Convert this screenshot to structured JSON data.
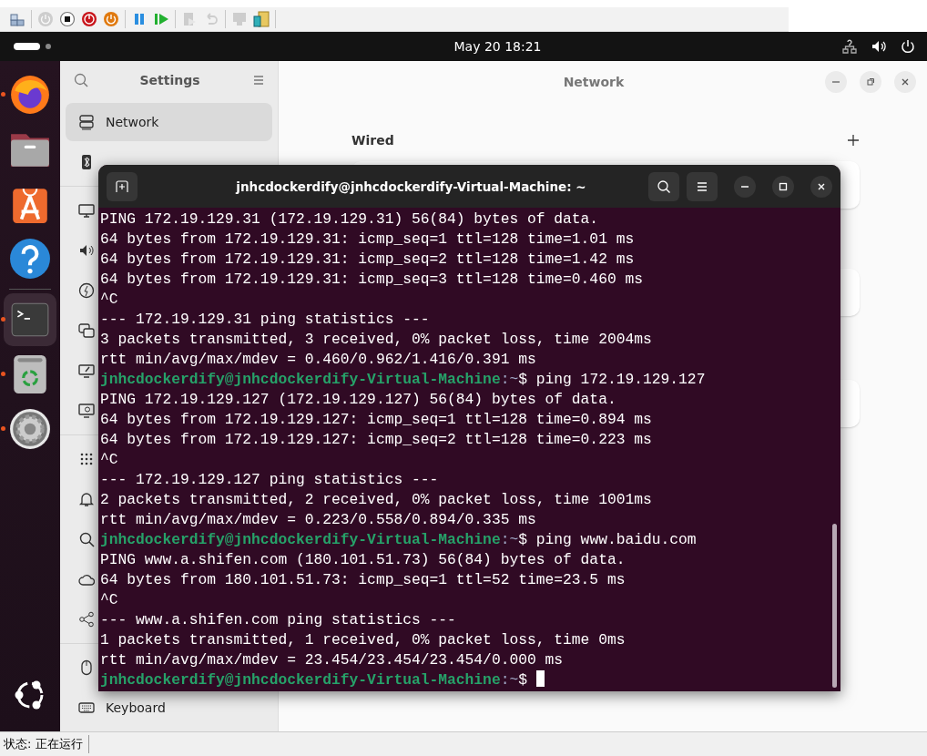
{
  "host_toolbar": {
    "groups": [
      [
        {
          "kind": "vm",
          "disabled": false
        }
      ],
      [
        {
          "kind": "power-off",
          "disabled": true
        },
        {
          "kind": "stop",
          "disabled": false
        },
        {
          "kind": "reset",
          "disabled": false
        },
        {
          "kind": "shutdown",
          "disabled": false
        }
      ],
      [
        {
          "kind": "pause",
          "disabled": false
        },
        {
          "kind": "play",
          "disabled": false
        }
      ],
      [
        {
          "kind": "snapshot",
          "disabled": true
        },
        {
          "kind": "revert",
          "disabled": true
        }
      ],
      [
        {
          "kind": "console",
          "disabled": true
        },
        {
          "kind": "archive",
          "disabled": false
        }
      ]
    ]
  },
  "top_bar": {
    "clock": "May 20  18:21"
  },
  "dock": {
    "items": [
      {
        "kind": "browser",
        "running": true,
        "selected": false
      },
      {
        "kind": "files",
        "running": false,
        "selected": false
      },
      {
        "kind": "store",
        "running": false,
        "selected": false
      },
      {
        "kind": "help",
        "running": false,
        "selected": false
      },
      {
        "kind": "terminal",
        "running": true,
        "selected": true
      },
      {
        "kind": "trash",
        "running": true,
        "selected": false
      },
      {
        "kind": "updater",
        "running": true,
        "selected": false
      }
    ]
  },
  "settings": {
    "sidebar": {
      "title": "Settings",
      "sections": [
        [
          {
            "kind": "network",
            "label": "Network",
            "selected": true
          },
          {
            "kind": "bluetooth",
            "selected": false
          }
        ],
        [
          {
            "kind": "display",
            "selected": false
          },
          {
            "kind": "sound",
            "selected": false
          },
          {
            "kind": "power",
            "selected": false
          },
          {
            "kind": "multitasking",
            "selected": false
          },
          {
            "kind": "appearance",
            "selected": false
          },
          {
            "kind": "desktop",
            "selected": false
          }
        ],
        [
          {
            "kind": "apps",
            "selected": false
          },
          {
            "kind": "bell",
            "selected": false
          },
          {
            "kind": "search",
            "selected": false
          },
          {
            "kind": "cloud",
            "selected": false
          },
          {
            "kind": "share",
            "selected": false
          }
        ],
        [
          {
            "kind": "mouse",
            "selected": false
          },
          {
            "kind": "keyboard",
            "label": "Keyboard",
            "selected": false
          }
        ]
      ]
    },
    "page_title": "Network",
    "section_title": "Wired"
  },
  "terminal": {
    "title": "jnhcdockerdify@jnhcdockerdify-Virtual-Machine: ~",
    "lines": [
      {
        "kind": "output",
        "text": "PING 172.19.129.31 (172.19.129.31) 56(84) bytes of data."
      },
      {
        "kind": "output",
        "text": "64 bytes from 172.19.129.31: icmp_seq=1 ttl=128 time=1.01 ms"
      },
      {
        "kind": "output",
        "text": "64 bytes from 172.19.129.31: icmp_seq=2 ttl=128 time=1.42 ms"
      },
      {
        "kind": "output",
        "text": "64 bytes from 172.19.129.31: icmp_seq=3 ttl=128 time=0.460 ms"
      },
      {
        "kind": "output",
        "text": "^C"
      },
      {
        "kind": "output",
        "text": "--- 172.19.129.31 ping statistics ---"
      },
      {
        "kind": "output",
        "text": "3 packets transmitted, 3 received, 0% packet loss, time 2004ms"
      },
      {
        "kind": "output",
        "text": "rtt min/avg/max/mdev = 0.460/0.962/1.416/0.391 ms"
      },
      {
        "kind": "prompt",
        "user": "jnhcdockerdify@jnhcdockerdify-Virtual-Machine",
        "path": ":~",
        "command": "$ ping 172.19.129.127",
        "cursor": false
      },
      {
        "kind": "output",
        "text": "PING 172.19.129.127 (172.19.129.127) 56(84) bytes of data."
      },
      {
        "kind": "output",
        "text": "64 bytes from 172.19.129.127: icmp_seq=1 ttl=128 time=0.894 ms"
      },
      {
        "kind": "output",
        "text": "64 bytes from 172.19.129.127: icmp_seq=2 ttl=128 time=0.223 ms"
      },
      {
        "kind": "output",
        "text": "^C"
      },
      {
        "kind": "output",
        "text": "--- 172.19.129.127 ping statistics ---"
      },
      {
        "kind": "output",
        "text": "2 packets transmitted, 2 received, 0% packet loss, time 1001ms"
      },
      {
        "kind": "output",
        "text": "rtt min/avg/max/mdev = 0.223/0.558/0.894/0.335 ms"
      },
      {
        "kind": "prompt",
        "user": "jnhcdockerdify@jnhcdockerdify-Virtual-Machine",
        "path": ":~",
        "command": "$ ping www.baidu.com",
        "cursor": false
      },
      {
        "kind": "output",
        "text": "PING www.a.shifen.com (180.101.51.73) 56(84) bytes of data."
      },
      {
        "kind": "output",
        "text": "64 bytes from 180.101.51.73: icmp_seq=1 ttl=52 time=23.5 ms"
      },
      {
        "kind": "output",
        "text": "^C"
      },
      {
        "kind": "output",
        "text": "--- www.a.shifen.com ping statistics ---"
      },
      {
        "kind": "output",
        "text": "1 packets transmitted, 1 received, 0% packet loss, time 0ms"
      },
      {
        "kind": "output",
        "text": "rtt min/avg/max/mdev = 23.454/23.454/23.454/0.000 ms"
      },
      {
        "kind": "prompt",
        "user": "jnhcdockerdify@jnhcdockerdify-Virtual-Machine",
        "path": ":~",
        "command": "$ ",
        "cursor": true
      }
    ]
  },
  "status_bar": {
    "text": "状态: 正在运行"
  }
}
